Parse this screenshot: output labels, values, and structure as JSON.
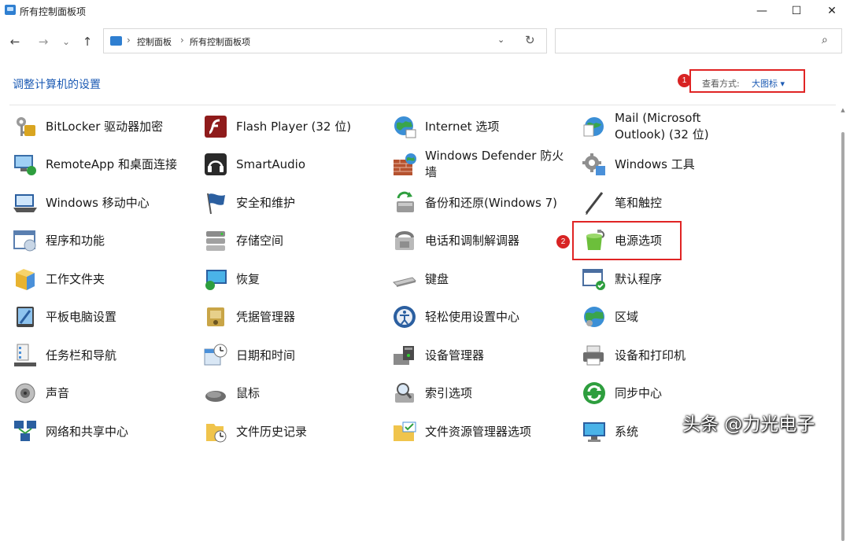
{
  "window": {
    "title": "所有控制面板项",
    "minimize": "—",
    "maximize": "☐",
    "close": "✕"
  },
  "nav": {
    "back": "←",
    "forward": "→",
    "recent": "⌄",
    "up": "↑"
  },
  "address": {
    "crumbs": [
      "控制面板",
      "所有控制面板项"
    ],
    "separator": "›",
    "dropdown": "⌄",
    "refresh": "↻"
  },
  "search": {
    "placeholder": "",
    "icon": "⌕"
  },
  "heading": "调整计算机的设置",
  "view_by": {
    "label": "查看方式:",
    "value": "大图标 ▾",
    "marker": "1"
  },
  "power_marker": "2",
  "columns": [
    [
      {
        "lines": [
          "BitLocker 驱动器加密"
        ],
        "icon": "bitlocker-icon"
      },
      {
        "lines": [
          "RemoteApp 和桌面连接"
        ],
        "icon": "remoteapp-icon"
      },
      {
        "lines": [
          "Windows 移动中心"
        ],
        "icon": "mobility-center-icon"
      },
      {
        "lines": [
          "程序和功能"
        ],
        "icon": "programs-features-icon"
      },
      {
        "lines": [
          "工作文件夹"
        ],
        "icon": "work-folders-icon"
      },
      {
        "lines": [
          "平板电脑设置"
        ],
        "icon": "tablet-settings-icon"
      },
      {
        "lines": [
          "任务栏和导航"
        ],
        "icon": "taskbar-icon"
      },
      {
        "lines": [
          "声音"
        ],
        "icon": "sound-icon"
      },
      {
        "lines": [
          "网络和共享中心"
        ],
        "icon": "network-icon"
      }
    ],
    [
      {
        "lines": [
          "Flash Player (32 位)"
        ],
        "icon": "flash-icon"
      },
      {
        "lines": [
          "SmartAudio"
        ],
        "icon": "smartaudio-icon"
      },
      {
        "lines": [
          "安全和维护"
        ],
        "icon": "security-flag-icon"
      },
      {
        "lines": [
          "存储空间"
        ],
        "icon": "storage-spaces-icon"
      },
      {
        "lines": [
          "恢复"
        ],
        "icon": "recovery-icon"
      },
      {
        "lines": [
          "凭据管理器"
        ],
        "icon": "credential-manager-icon"
      },
      {
        "lines": [
          "日期和时间"
        ],
        "icon": "date-time-icon"
      },
      {
        "lines": [
          "鼠标"
        ],
        "icon": "mouse-icon"
      },
      {
        "lines": [
          "文件历史记录"
        ],
        "icon": "file-history-icon"
      }
    ],
    [
      {
        "lines": [
          "Internet 选项"
        ],
        "icon": "internet-options-icon"
      },
      {
        "lines": [
          "Windows Defender 防火",
          "墙"
        ],
        "icon": "firewall-icon"
      },
      {
        "lines": [
          "备份和还原(Windows 7)"
        ],
        "icon": "backup-restore-icon"
      },
      {
        "lines": [
          "电话和调制解调器"
        ],
        "icon": "phone-modem-icon"
      },
      {
        "lines": [
          "键盘"
        ],
        "icon": "keyboard-icon"
      },
      {
        "lines": [
          "轻松使用设置中心"
        ],
        "icon": "ease-of-access-icon"
      },
      {
        "lines": [
          "设备管理器"
        ],
        "icon": "device-manager-icon"
      },
      {
        "lines": [
          "索引选项"
        ],
        "icon": "indexing-icon"
      },
      {
        "lines": [
          "文件资源管理器选项"
        ],
        "icon": "explorer-options-icon"
      }
    ],
    [
      {
        "lines": [
          "Mail (Microsoft",
          "Outlook) (32 位)"
        ],
        "icon": "mail-icon"
      },
      {
        "lines": [
          "Windows 工具"
        ],
        "icon": "windows-tools-icon"
      },
      {
        "lines": [
          "笔和触控"
        ],
        "icon": "pen-touch-icon"
      },
      {
        "lines": [
          "电源选项"
        ],
        "icon": "power-options-icon"
      },
      {
        "lines": [
          "默认程序"
        ],
        "icon": "default-programs-icon"
      },
      {
        "lines": [
          "区域"
        ],
        "icon": "region-icon"
      },
      {
        "lines": [
          "设备和打印机"
        ],
        "icon": "devices-printers-icon"
      },
      {
        "lines": [
          "同步中心"
        ],
        "icon": "sync-center-icon"
      },
      {
        "lines": [
          "系统"
        ],
        "icon": "system-icon"
      }
    ]
  ],
  "watermark": "头条 @力光电子"
}
